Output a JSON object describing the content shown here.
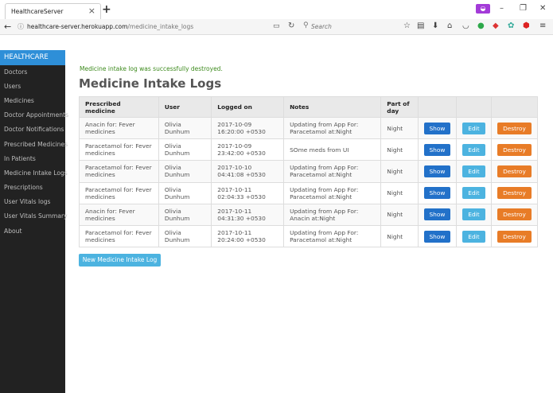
{
  "browser": {
    "tab_title": "HealthcareServer",
    "url_host": "healthcare-server.herokuapp.com",
    "url_path": "/medicine_intake_logs",
    "search_placeholder": "Search"
  },
  "sidebar": {
    "brand": "HEALTHCARE",
    "items": [
      {
        "label": "Doctors"
      },
      {
        "label": "Users"
      },
      {
        "label": "Medicines"
      },
      {
        "label": "Doctor Appointments"
      },
      {
        "label": "Doctor Notifications"
      },
      {
        "label": "Prescribed Medicines"
      },
      {
        "label": "In Patients"
      },
      {
        "label": "Medicine Intake Logs"
      },
      {
        "label": "Prescriptions"
      },
      {
        "label": "User Vitals logs"
      },
      {
        "label": "User Vitals Summary"
      },
      {
        "label": "About"
      }
    ]
  },
  "notice": "Medicine intake log was successfully destroyed.",
  "page_title": "Medicine Intake Logs",
  "table": {
    "headers": [
      "Prescribed medicine",
      "User",
      "Logged on",
      "Notes",
      "Part of day"
    ],
    "rows": [
      {
        "medicine": "Anacin for: Fever medicines",
        "user": "Olivia Dunhum",
        "logged_on": "2017-10-09 16:20:00 +0530",
        "notes": "Updating from App For: Paracetamol at:Night",
        "part_of_day": "Night"
      },
      {
        "medicine": "Paracetamol for: Fever medicines",
        "user": "Olivia Dunhum",
        "logged_on": "2017-10-09 23:42:00 +0530",
        "notes": "SOme meds from UI",
        "part_of_day": "Night"
      },
      {
        "medicine": "Paracetamol for: Fever medicines",
        "user": "Olivia Dunhum",
        "logged_on": "2017-10-10 04:41:08 +0530",
        "notes": "Updating from App For: Paracetamol at:Night",
        "part_of_day": "Night"
      },
      {
        "medicine": "Paracetamol for: Fever medicines",
        "user": "Olivia Dunhum",
        "logged_on": "2017-10-11 02:04:33 +0530",
        "notes": "Updating from App For: Paracetamol at:Night",
        "part_of_day": "Night"
      },
      {
        "medicine": "Anacin for: Fever medicines",
        "user": "Olivia Dunhum",
        "logged_on": "2017-10-11 04:31:30 +0530",
        "notes": "Updating from App For: Anacin at:Night",
        "part_of_day": "Night"
      },
      {
        "medicine": "Paracetamol for: Fever medicines",
        "user": "Olivia Dunhum",
        "logged_on": "2017-10-11 20:24:00 +0530",
        "notes": "Updating from App For: Paracetamol at:Night",
        "part_of_day": "Night"
      }
    ],
    "actions": {
      "show": "Show",
      "edit": "Edit",
      "destroy": "Destroy"
    }
  },
  "new_button": "New Medicine Intake Log",
  "colors": {
    "brand": "#2e8fd8",
    "sidebar_bg": "#222222",
    "show_button": "#2271c9",
    "edit_button": "#4cb3e0",
    "destroy_button": "#e87c27",
    "notice_text": "#3c8a1c"
  }
}
